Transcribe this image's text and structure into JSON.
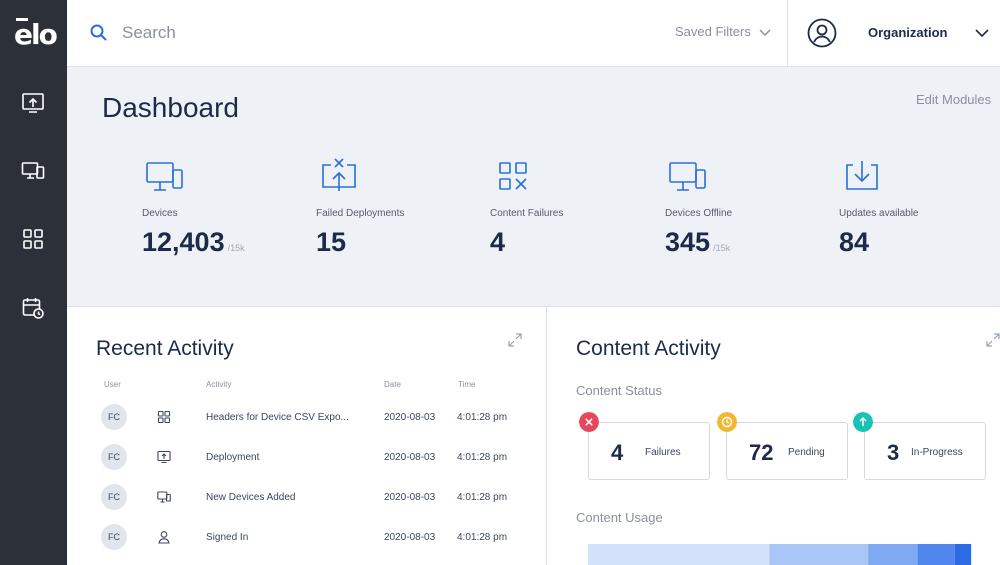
{
  "brand": {
    "logo_text": "elo"
  },
  "colors": {
    "accent": "#2a6fdb",
    "sidebar": "#2c3038",
    "failure": "#e5485a",
    "pending": "#f3b630",
    "progress": "#18c2b4"
  },
  "sidebar": {
    "items": [
      {
        "name": "upload-icon"
      },
      {
        "name": "devices-icon"
      },
      {
        "name": "modules-icon"
      },
      {
        "name": "schedule-icon"
      }
    ]
  },
  "header": {
    "search_placeholder": "Search",
    "saved_filters": "Saved Filters",
    "organization": "Organization"
  },
  "dashboard": {
    "title": "Dashboard",
    "edit_modules": "Edit Modules",
    "stats": [
      {
        "label": "Devices",
        "value": "12,403",
        "sub": "/15k",
        "icon": "devices-icon"
      },
      {
        "label": "Failed Deployments",
        "value": "15",
        "sub": "",
        "icon": "failed-deploy-icon"
      },
      {
        "label": "Content Failures",
        "value": "4",
        "sub": "",
        "icon": "content-failure-icon"
      },
      {
        "label": "Devices Offline",
        "value": "345",
        "sub": "/15k",
        "icon": "devices-offline-icon"
      },
      {
        "label": "Updates available",
        "value": "84",
        "sub": "",
        "icon": "download-icon"
      }
    ]
  },
  "recent_activity": {
    "title": "Recent Activity",
    "columns": [
      "User",
      "Activity",
      "Date",
      "Time"
    ],
    "rows": [
      {
        "user": "FC",
        "icon": "modules-icon",
        "activity": "Headers for Device CSV Expo...",
        "date": "2020-08-03",
        "time": "4:01:28 pm"
      },
      {
        "user": "FC",
        "icon": "upload-icon",
        "activity": "Deployment",
        "date": "2020-08-03",
        "time": "4:01:28 pm"
      },
      {
        "user": "FC",
        "icon": "devices-icon",
        "activity": "New Devices Added",
        "date": "2020-08-03",
        "time": "4:01:28 pm"
      },
      {
        "user": "FC",
        "icon": "user-icon",
        "activity": "Signed In",
        "date": "2020-08-03",
        "time": "4:01:28 pm"
      }
    ]
  },
  "content_activity": {
    "title": "Content Activity",
    "status_label": "Content Status",
    "statuses": [
      {
        "value": "4",
        "label": "Failures"
      },
      {
        "value": "72",
        "label": "Pending"
      },
      {
        "value": "3",
        "label": "In-Progress"
      }
    ],
    "usage_label": "Content Usage",
    "usage_segments": [
      {
        "share": 0.44,
        "color": "#d3e2fb"
      },
      {
        "share": 0.24,
        "color": "#a9c6f7"
      },
      {
        "share": 0.12,
        "color": "#7fa9f3"
      },
      {
        "share": 0.09,
        "color": "#4f87ee"
      },
      {
        "share": 0.04,
        "color": "#2d6be6"
      }
    ]
  }
}
